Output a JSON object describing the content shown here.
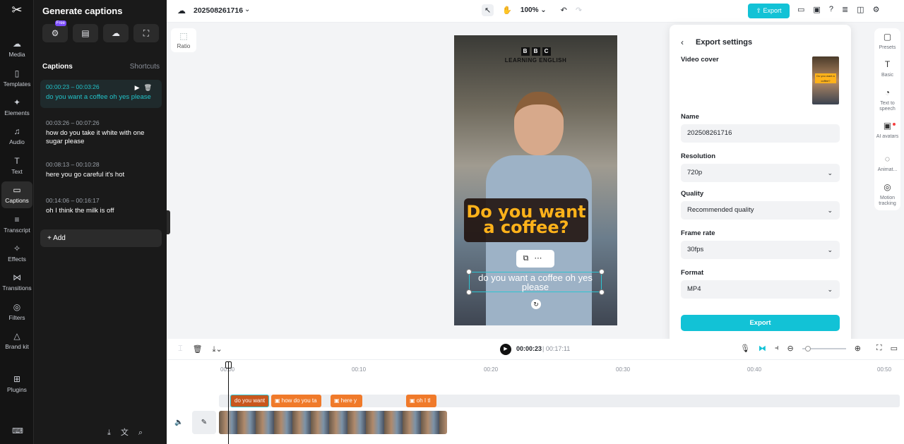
{
  "rail": {
    "items": [
      {
        "label": "Media",
        "icon": "media-icon",
        "glyph": "☁"
      },
      {
        "label": "Templates",
        "icon": "templates-icon",
        "glyph": "▯"
      },
      {
        "label": "Elements",
        "icon": "elements-icon",
        "glyph": "✦"
      },
      {
        "label": "Audio",
        "icon": "audio-icon",
        "glyph": "♫"
      },
      {
        "label": "Text",
        "icon": "text-icon",
        "glyph": "T"
      },
      {
        "label": "Captions",
        "icon": "captions-icon",
        "glyph": "▭"
      },
      {
        "label": "Transcript",
        "icon": "transcript-icon",
        "glyph": "≡"
      },
      {
        "label": "Effects",
        "icon": "effects-icon",
        "glyph": "✧"
      },
      {
        "label": "Transitions",
        "icon": "transitions-icon",
        "glyph": "⋈"
      },
      {
        "label": "Filters",
        "icon": "filters-icon",
        "glyph": "◎"
      },
      {
        "label": "Brand kit",
        "icon": "brand-kit-icon",
        "glyph": "△"
      },
      {
        "label": "Plugins",
        "icon": "plugins-icon",
        "glyph": "⊞"
      }
    ]
  },
  "panel": {
    "title": "Generate captions",
    "free_badge": "Free",
    "captions_heading": "Captions",
    "shortcuts": "Shortcuts",
    "items": [
      {
        "time": "00:00:23 – 00:03:26",
        "text": "do you want a coffee oh yes please"
      },
      {
        "time": "00:03:26 – 00:07:26",
        "text": "how do you take it white with one sugar please"
      },
      {
        "time": "00:08:13 – 00:10:28",
        "text": "here you go careful it's hot"
      },
      {
        "time": "00:14:06 – 00:16:17",
        "text": "oh I think the milk is off"
      }
    ],
    "add_label": "Add"
  },
  "topbar": {
    "project_name": "202508261716",
    "zoom": "100%",
    "export_label": "Export"
  },
  "ratio_label": "Ratio",
  "video": {
    "bbc_letters": [
      "B",
      "B",
      "C"
    ],
    "bbc_sub": "LEARNING ENGLISH",
    "big_caption": "Do you want a coffee?",
    "subtitle": "do you want a coffee oh yes please"
  },
  "export_settings": {
    "title": "Export settings",
    "video_cover_label": "Video cover",
    "cover_text": "Do you want a coffee?",
    "name_label": "Name",
    "name_value": "202508261716",
    "resolution_label": "Resolution",
    "resolution_value": "720p",
    "quality_label": "Quality",
    "quality_value": "Recommended quality",
    "frame_rate_label": "Frame rate",
    "frame_rate_value": "30fps",
    "format_label": "Format",
    "format_value": "MP4",
    "export_button": "Export"
  },
  "right_rail": {
    "items": [
      {
        "label": "Presets",
        "icon": "presets-icon"
      },
      {
        "label": "Basic",
        "icon": "basic-text-icon"
      },
      {
        "label": "Text to speech",
        "icon": "text-to-speech-icon"
      },
      {
        "label": "AI avatars",
        "icon": "ai-avatars-icon"
      },
      {
        "label": "Animat...",
        "icon": "animation-icon"
      },
      {
        "label": "Motion tracking",
        "icon": "motion-tracking-icon"
      }
    ]
  },
  "timeline": {
    "current_time": "00:00:23",
    "total_time": "00:17:11",
    "ruler": [
      "00:00",
      "00:10",
      "00:20",
      "00:30",
      "00:40",
      "00:50"
    ],
    "caption_clips": [
      "do you want",
      "how do you ta",
      "here y",
      "oh I tl"
    ]
  }
}
